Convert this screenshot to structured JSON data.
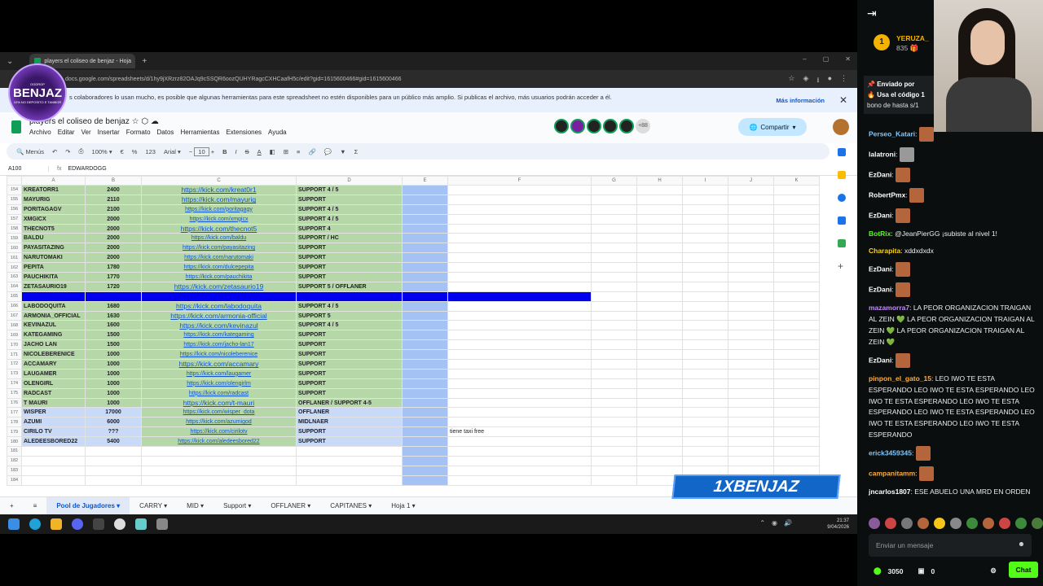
{
  "browser": {
    "tab_title": "players el coliseo de benjaz - Hoja",
    "url": "docs.google.com/spreadsheets/d/1hy9jXRzrz82OAJq9cSSQR6oozQUHYRagcCXHCaafH5c/edit?gid=1615600466#gid=1615600466"
  },
  "banner": {
    "message": "s colaboradores lo usan mucho, es posible que algunas herramientas para este spreadsheet no estén disponibles para un público más amplio. Si publicas el archivo, más usuarios podrán acceder a él.",
    "more": "Más información"
  },
  "doc": {
    "title": "players el coliseo de benjaz",
    "menus": [
      "Archivo",
      "Editar",
      "Ver",
      "Insertar",
      "Formato",
      "Datos",
      "Herramientas",
      "Extensiones",
      "Ayuda"
    ],
    "collab_more": "+88",
    "share": "Compartir"
  },
  "toolbar": {
    "menus": "Menús",
    "zoom": "100%",
    "currency": "€",
    "percent": "%",
    "fmt": "123",
    "font": "Arial",
    "size": "10"
  },
  "formula": {
    "ref": "A100",
    "value": "EDWARDOGG"
  },
  "columns": [
    "A",
    "B",
    "C",
    "D",
    "E",
    "F",
    "G",
    "H",
    "I",
    "J",
    "K"
  ],
  "rows": [
    {
      "n": "154",
      "name": "KREATORR1",
      "val": "2400",
      "link": "https://kick.com/kreat0r1",
      "role": "SUPPORT 4 / 5",
      "style": "green",
      "big": true
    },
    {
      "n": "155",
      "name": "MAYURIG",
      "val": "2110",
      "link": "https://kick.com/mayurig",
      "role": "SUPPORT",
      "style": "green",
      "big": true
    },
    {
      "n": "156",
      "name": "PORITAGAGV",
      "val": "2100",
      "link": "https://kick.com/poritagagy",
      "role": "SUPPORT 4 / 5",
      "style": "green"
    },
    {
      "n": "157",
      "name": "XMGICX",
      "val": "2000",
      "link": "https://kick.com/xmgicx",
      "role": "SUPPORT 4 / 5",
      "style": "green"
    },
    {
      "n": "158",
      "name": "THECNOT5",
      "val": "2000",
      "link": "https://kick.com/thecnot5",
      "role": "SUPPORT 4",
      "style": "green",
      "big": true
    },
    {
      "n": "159",
      "name": "BALDU",
      "val": "2000",
      "link": "https://kick.com/baldu",
      "role": "SUPPORT / HC",
      "style": "green"
    },
    {
      "n": "160",
      "name": "PAYASITAZING",
      "val": "2000",
      "link": "https://kick.com/payasitazing",
      "role": "SUPPORT",
      "style": "green"
    },
    {
      "n": "161",
      "name": "NARUTOMAKI",
      "val": "2000",
      "link": "https://kick.com/narutomaki",
      "role": "SUPPORT",
      "style": "green"
    },
    {
      "n": "162",
      "name": "PEPITA",
      "val": "1780",
      "link": "https://kick.com/dulcepepita",
      "role": "SUPPORT",
      "style": "green"
    },
    {
      "n": "163",
      "name": "PAUCHIKITA",
      "val": "1770",
      "link": "https://kick.com/pauchikita",
      "role": "SUPPORT",
      "style": "green"
    },
    {
      "n": "164",
      "name": "ZETASAURIO19",
      "val": "1720",
      "link": "https://kick.com/zetasaurio19",
      "role": "SUPPORT 5 / OFFLANER",
      "style": "green",
      "big": true
    },
    {
      "n": "165",
      "name": "",
      "val": "",
      "link": "",
      "role": "",
      "style": "bluebar"
    },
    {
      "n": "166",
      "name": "LABODOQUITA",
      "val": "1680",
      "link": "https://kick.com/labodoquita",
      "role": "SUPPORT 4 / 5",
      "style": "green",
      "big": true
    },
    {
      "n": "167",
      "name": "ARMONIA_OFFICIAL",
      "val": "1630",
      "link": "https://kick.com/armonia-official",
      "role": "SUPPORT 5",
      "style": "green",
      "big": true
    },
    {
      "n": "168",
      "name": "KEVINAZUL",
      "val": "1600",
      "link": "https://kick.com/kevinazul",
      "role": "SUPPORT 4 / 5",
      "style": "green",
      "big": true
    },
    {
      "n": "169",
      "name": "KATEGAMING",
      "val": "1500",
      "link": "https://kick.com/kategaming",
      "role": "SUPPORT",
      "style": "green"
    },
    {
      "n": "170",
      "name": "JACHO LAN",
      "val": "1500",
      "link": "https://kick.com/jacho-lan17",
      "role": "SUPPORT",
      "style": "green"
    },
    {
      "n": "171",
      "name": "NICOLEBERENICE",
      "val": "1000",
      "link": "https://kick.com/nicoleberenice",
      "role": "SUPPORT",
      "style": "green"
    },
    {
      "n": "172",
      "name": "ACCAMARY",
      "val": "1000",
      "link": "https://kick.com/accamary",
      "role": "SUPPORT",
      "style": "green",
      "big": true
    },
    {
      "n": "173",
      "name": "LAUGAMER",
      "val": "1000",
      "link": "https://kick.com/laugamer",
      "role": "SUPPORT",
      "style": "green"
    },
    {
      "n": "174",
      "name": "OLENGIRL",
      "val": "1000",
      "link": "https://kick.com/olengirlm",
      "role": "SUPPORT",
      "style": "green"
    },
    {
      "n": "175",
      "name": "RADCAST",
      "val": "1000",
      "link": "https://kick.com/radcast",
      "role": "SUPPORT",
      "style": "green"
    },
    {
      "n": "176",
      "name": "T MAURI",
      "val": "1000",
      "link": "https://kick.com/t-mauri",
      "role": "OFFLANER / SUPPORT 4-5",
      "style": "green",
      "big": true
    },
    {
      "n": "177",
      "name": "WISPER",
      "val": "17000",
      "link": "https://kick.com/wisper_dota",
      "role": "OFFLANER",
      "style": "blue"
    },
    {
      "n": "178",
      "name": "AZUMI",
      "val": "6000",
      "link": "https://kick.com/azumigod",
      "role": "MIDLNAER",
      "style": "blue"
    },
    {
      "n": "179",
      "name": "CIRILO TV",
      "val": "???",
      "link": "https://kick.com/cirilotv",
      "role": "SUPPORT",
      "style": "blue",
      "note": "tiene taxi free"
    },
    {
      "n": "180",
      "name": "ALEDEESBORED22",
      "val": "5400",
      "link": "https://kick.com/aledeesbored22",
      "role": "SUPPORT",
      "style": "blue"
    },
    {
      "n": "181",
      "name": "",
      "val": "",
      "link": "",
      "role": "",
      "style": "empty"
    },
    {
      "n": "182",
      "name": "",
      "val": "",
      "link": "",
      "role": "",
      "style": "empty"
    },
    {
      "n": "183",
      "name": "",
      "val": "",
      "link": "",
      "role": "",
      "style": "empty"
    },
    {
      "n": "184",
      "name": "",
      "val": "",
      "link": "",
      "role": "",
      "style": "empty"
    }
  ],
  "sheet_tabs": [
    "Pool de Jugadores",
    "CARRY",
    "MID",
    "Support",
    "OFFLANER",
    "CAPITANES",
    "Hoja 1"
  ],
  "overlay": {
    "logo": "BENJAZ",
    "logo_top": "OGDROP",
    "logo_sub": "10% NO DEPOSITO E TAMBOR",
    "brand": "1XBENJAZ"
  },
  "taskbar": {
    "time": "21:37",
    "date": "9/04/2026"
  },
  "chat": {
    "gift_rank": "1",
    "gift_user": "YERUZA_",
    "gift_count": "835",
    "pinned_by": "Enviado por",
    "pinned_text": "Usa el código 1",
    "pinned_text2": "bono de hasta s/1",
    "messages": [
      {
        "user": "Perseo_Katari",
        "color": "#7ec8ff",
        "text": "",
        "emote": "face"
      },
      {
        "user": "lalatroni",
        "color": "#ffffff",
        "text": "",
        "emote": "cat"
      },
      {
        "user": "EzDani",
        "color": "#ffffff",
        "text": "",
        "emote": "face"
      },
      {
        "user": "RobertPmx",
        "color": "#ffffff",
        "text": "",
        "emote": "face"
      },
      {
        "user": "EzDani",
        "color": "#ffffff",
        "text": "",
        "emote": "face"
      },
      {
        "user": "BotRix",
        "color": "#53fc18",
        "text": "@JeanPierGG ¡subiste al nivel 1!",
        "emote": ""
      },
      {
        "user": "Charapita",
        "color": "#ffd400",
        "text": "xddxdxdx",
        "emote": ""
      },
      {
        "user": "EzDani",
        "color": "#ffffff",
        "text": "",
        "emote": "face"
      },
      {
        "user": "EzDani",
        "color": "#ffffff",
        "text": "",
        "emote": "face"
      },
      {
        "user": "mazamorra7",
        "color": "#c58aff",
        "text": "LA PEOR ORGANIZACION TRAIGAN AL ZEIN 💚 LA PEOR ORGANIZACION TRAIGAN AL ZEIN 💚 LA PEOR ORGANIZACION TRAIGAN AL ZEIN 💚",
        "emote": ""
      },
      {
        "user": "EzDani",
        "color": "#ffffff",
        "text": "",
        "emote": "face"
      },
      {
        "user": "pinpon_el_gato_15",
        "color": "#ffae3d",
        "text": "LEO IWO TE ESTA ESPERANDO LEO IWO TE ESTA ESPERANDO LEO IWO TE ESTA ESPERANDO LEO IWO TE ESTA ESPERANDO LEO IWO TE ESTA ESPERANDO LEO IWO TE ESTA ESPERANDO LEO IWO TE ESTA ESPERANDO",
        "emote": ""
      },
      {
        "user": "erick3459345",
        "color": "#7ec8ff",
        "text": "",
        "emote": "face"
      },
      {
        "user": "campanitamm",
        "color": "#ffae3d",
        "text": "",
        "emote": "face"
      },
      {
        "user": "jncarlos1807",
        "color": "#ffffff",
        "text": "ESE ABUELO UNA MRD EN ORDEN",
        "emote": ""
      }
    ],
    "input_placeholder": "Enviar un mensaje",
    "points": "3050",
    "gifts": "0",
    "send": "Chat"
  }
}
